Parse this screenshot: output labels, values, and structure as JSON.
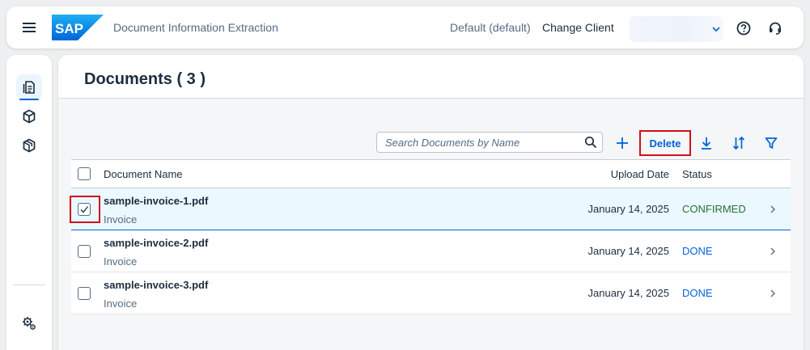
{
  "shell": {
    "logo_text": "SAP",
    "app_title": "Document Information Extraction",
    "client_default": "Default (default)",
    "change_client_label": "Change Client",
    "brand_color": "#0070f2",
    "icons": [
      "menu-icon",
      "chevron-down-icon",
      "help-icon",
      "support-icon"
    ]
  },
  "sidenav": {
    "items": [
      {
        "name": "documents",
        "icon": "document-icon",
        "active": true
      },
      {
        "name": "schemas",
        "icon": "cube-icon",
        "active": false
      },
      {
        "name": "templates",
        "icon": "box-icon",
        "active": false
      }
    ],
    "bottom_icon": "settings-icon"
  },
  "page": {
    "title": "Documents ( 3 )"
  },
  "toolbar": {
    "search_placeholder": "Search Documents by Name",
    "delete_label": "Delete",
    "icons": [
      "add-icon",
      "download-icon",
      "sort-icon",
      "filter-icon"
    ]
  },
  "table": {
    "columns": {
      "name": "Document Name",
      "date": "Upload Date",
      "status": "Status"
    },
    "rows": [
      {
        "name": "sample-invoice-1.pdf",
        "type": "Invoice",
        "date": "January 14, 2025",
        "status": "CONFIRMED",
        "selected": true
      },
      {
        "name": "sample-invoice-2.pdf",
        "type": "Invoice",
        "date": "January 14, 2025",
        "status": "DONE",
        "selected": false
      },
      {
        "name": "sample-invoice-3.pdf",
        "type": "Invoice",
        "date": "January 14, 2025",
        "status": "DONE",
        "selected": false
      }
    ]
  },
  "colors": {
    "accent": "#0064d9",
    "confirmed": "#256f3a",
    "highlight": "#d0101b",
    "selected_row": "#ebf8ff"
  }
}
